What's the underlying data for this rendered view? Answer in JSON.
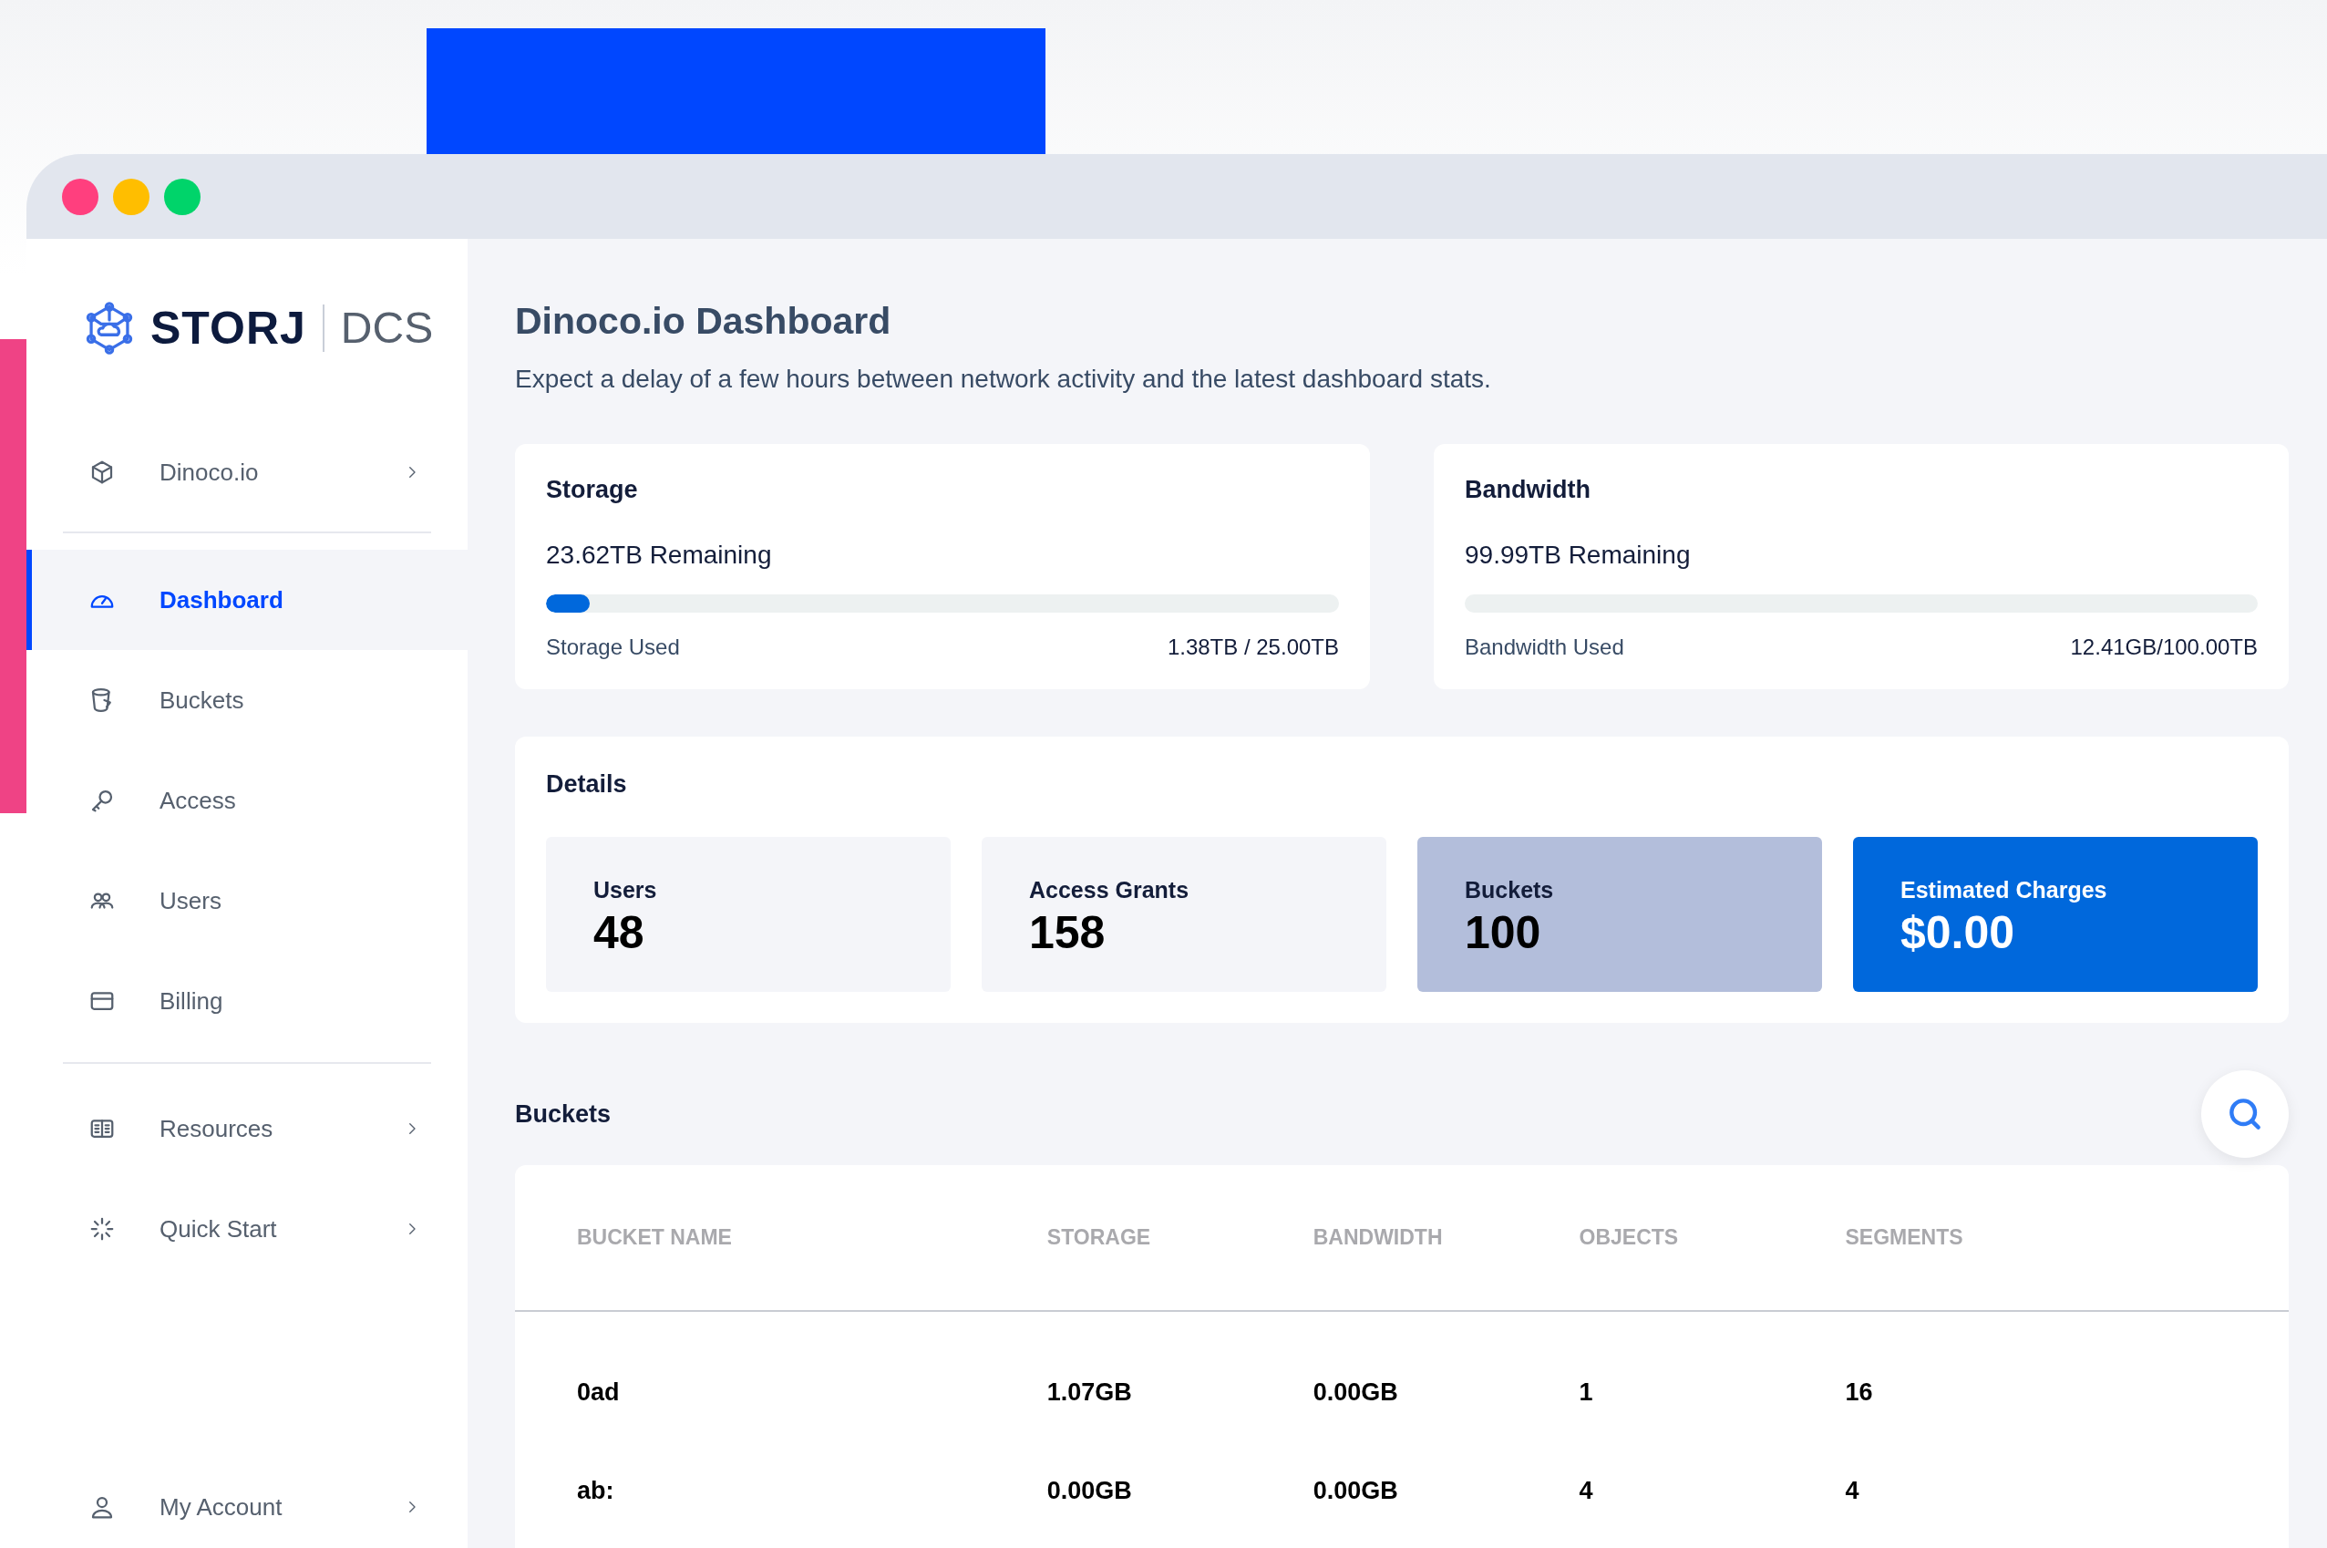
{
  "logo": {
    "brand": "STORJ",
    "product": "DCS"
  },
  "sidebar": {
    "groups": [
      {
        "items": [
          {
            "label": "Dinoco.io",
            "selected": false,
            "expandable": true
          }
        ]
      },
      {
        "items": [
          {
            "label": "Dashboard",
            "selected": true,
            "expandable": false
          },
          {
            "label": "Buckets",
            "selected": false,
            "expandable": false
          },
          {
            "label": "Access",
            "selected": false,
            "expandable": false
          },
          {
            "label": "Users",
            "selected": false,
            "expandable": false
          },
          {
            "label": "Billing",
            "selected": false,
            "expandable": false
          }
        ]
      },
      {
        "items": [
          {
            "label": "Resources",
            "selected": false,
            "expandable": true
          },
          {
            "label": "Quick Start",
            "selected": false,
            "expandable": true
          }
        ]
      }
    ],
    "account": {
      "label": "My Account",
      "expandable": true
    }
  },
  "page": {
    "title": "Dinoco.io Dashboard",
    "subtitle": "Expect a delay of a few hours between network activity and the latest dashboard stats."
  },
  "usage_cards": [
    {
      "title": "Storage",
      "remaining": "23.62TB Remaining",
      "level": 0.055,
      "used_label": "Storage Used",
      "used_value": "1.38TB / 25.00TB"
    },
    {
      "title": "Bandwidth",
      "remaining": "99.99TB Remaining",
      "level": 0.0,
      "used_label": "Bandwidth Used",
      "used_value": "12.41GB/100.00TB"
    }
  ],
  "details": {
    "title": "Details",
    "tiles": [
      {
        "label": "Users",
        "value": "48",
        "color": "#f4f5f9"
      },
      {
        "label": "Access Grants",
        "value": "158",
        "color": "#f4f5f9"
      },
      {
        "label": "Buckets",
        "value": "100",
        "color": "#b3bedb"
      },
      {
        "label": "Estimated Charges",
        "value": "$0.00",
        "color": "#0068dc"
      }
    ]
  },
  "buckets": {
    "title": "Buckets",
    "columns": [
      "BUCKET NAME",
      "STORAGE",
      "BANDWIDTH",
      "OBJECTS",
      "SEGMENTS"
    ],
    "rows": [
      [
        "0ad",
        "1.07GB",
        "0.00GB",
        "1",
        "16"
      ],
      [
        "ab:",
        "0.00GB",
        "0.00GB",
        "4",
        "4"
      ]
    ]
  }
}
